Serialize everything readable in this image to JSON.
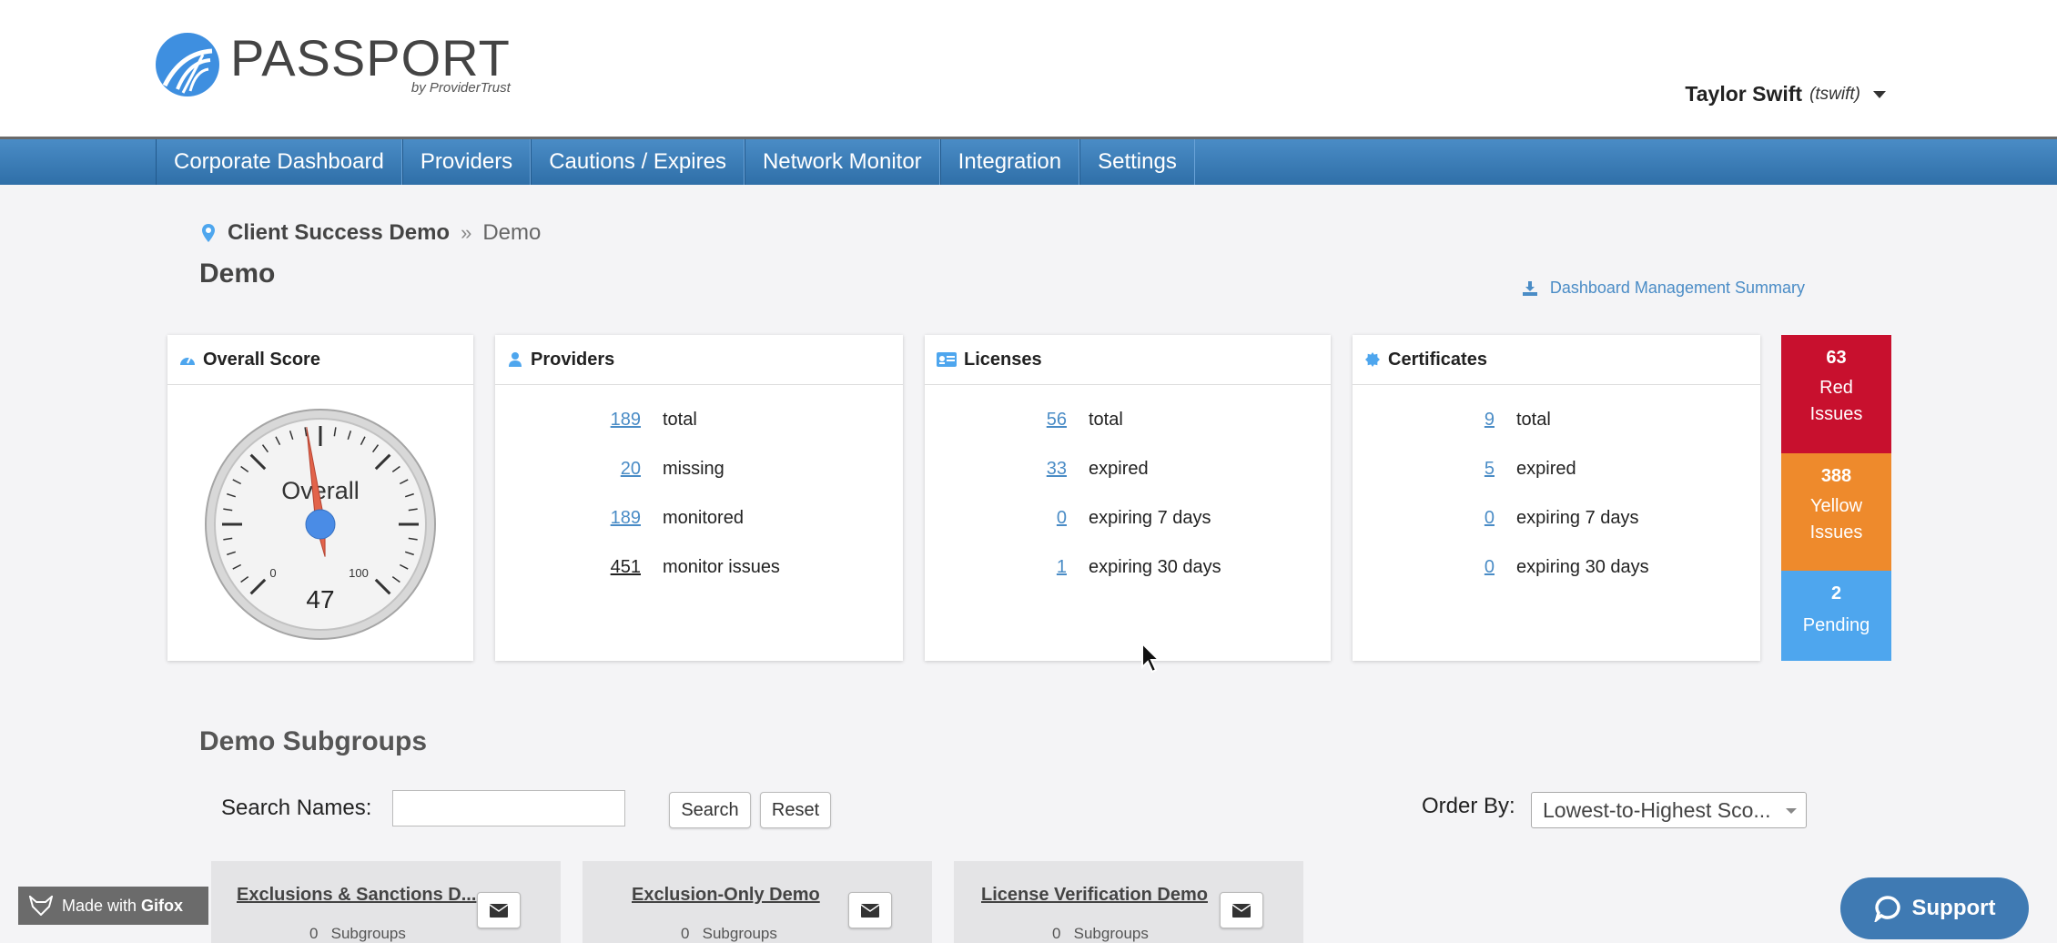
{
  "brand": {
    "name": "PASSPORT",
    "tagline": "by ProviderTrust",
    "accent": "#3e8fe0"
  },
  "user": {
    "name": "Taylor Swift",
    "handle": "(tswift)"
  },
  "nav": [
    "Corporate Dashboard",
    "Providers",
    "Cautions / Expires",
    "Network Monitor",
    "Integration",
    "Settings"
  ],
  "breadcrumb": {
    "root": "Client Success Demo",
    "sep": "»",
    "leaf": "Demo"
  },
  "page_title": "Demo",
  "summary_link": "Dashboard Management Summary",
  "overall": {
    "title": "Overall Score",
    "gauge_label": "Overall",
    "score": "47",
    "score_value": 47,
    "min": "0",
    "max": "100"
  },
  "providers": {
    "title": "Providers",
    "rows": [
      {
        "num": "189",
        "label": "total"
      },
      {
        "num": "20",
        "label": "missing"
      },
      {
        "num": "189",
        "label": "monitored"
      },
      {
        "num": "451",
        "label": "monitor issues"
      }
    ]
  },
  "licenses": {
    "title": "Licenses",
    "rows": [
      {
        "num": "56",
        "label": "total"
      },
      {
        "num": "33",
        "label": "expired"
      },
      {
        "num": "0",
        "label": "expiring 7 days"
      },
      {
        "num": "1",
        "label": "expiring 30 days"
      }
    ]
  },
  "certificates": {
    "title": "Certificates",
    "rows": [
      {
        "num": "9",
        "label": "total"
      },
      {
        "num": "5",
        "label": "expired"
      },
      {
        "num": "0",
        "label": "expiring 7 days"
      },
      {
        "num": "0",
        "label": "expiring 30 days"
      }
    ]
  },
  "issues": {
    "red": {
      "count": "63",
      "line1": "Red",
      "line2": "Issues",
      "color": "#c8102e"
    },
    "yellow": {
      "count": "388",
      "line1": "Yellow",
      "line2": "Issues",
      "color": "#ee8a2c"
    },
    "pending": {
      "count": "2",
      "line1": "Pending",
      "color": "#4ea6ee"
    }
  },
  "subgroups": {
    "title": "Demo Subgroups",
    "search_label": "Search Names:",
    "search_value": "",
    "search_button": "Search",
    "reset_button": "Reset",
    "order_label": "Order By:",
    "order_value": "Lowest-to-Highest Sco...",
    "groups": [
      {
        "name": "Exclusions & Sanctions D...",
        "count": "0",
        "sub_label": "Subgroups"
      },
      {
        "name": "Exclusion-Only Demo",
        "count": "0",
        "sub_label": "Subgroups"
      },
      {
        "name": "License Verification Demo",
        "count": "0",
        "sub_label": "Subgroups"
      }
    ]
  },
  "gifox": {
    "made": "Made with",
    "brand": "Gifox"
  },
  "support": "Support"
}
